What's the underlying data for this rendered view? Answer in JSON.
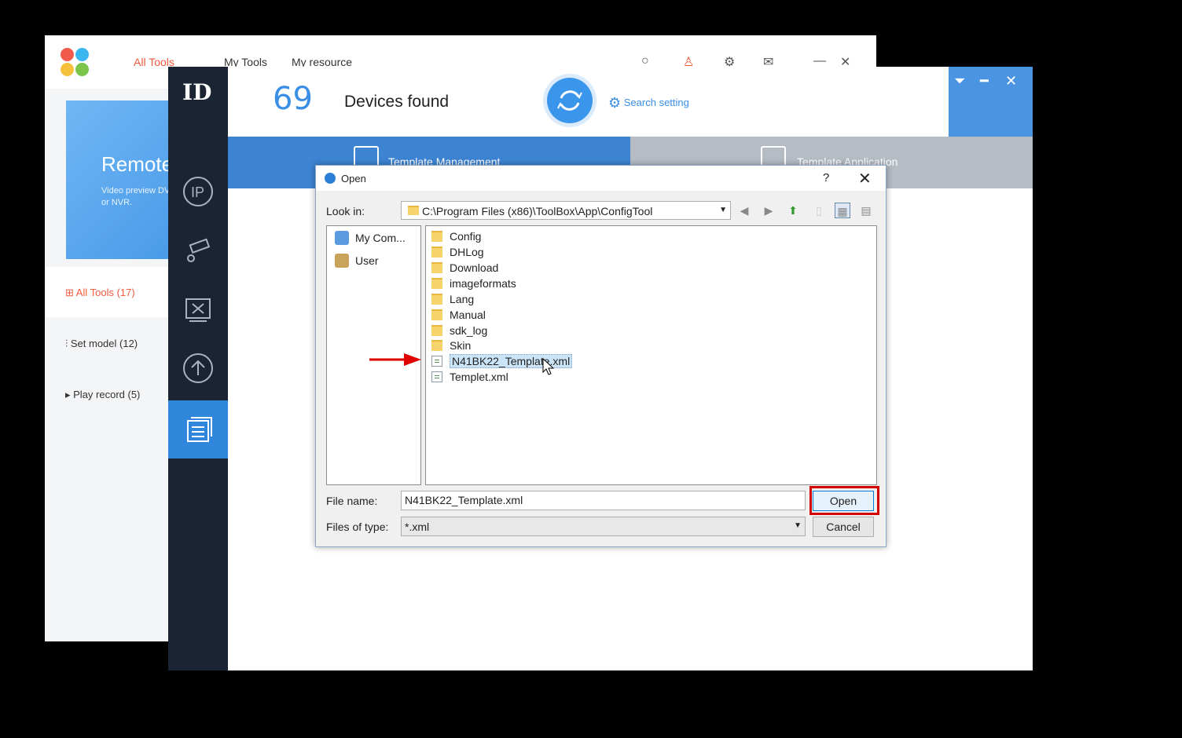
{
  "toolbox": {
    "tabs": [
      "All Tools",
      "My Tools",
      "My resource"
    ],
    "banner_title": "Remote",
    "banner_text": "Video preview DVR or NVR.",
    "menu": [
      "All Tools (17)",
      "Set model (12)",
      "Play record (5)"
    ]
  },
  "config": {
    "device_count": "69",
    "devices_found_label": "Devices found",
    "search_setting_label": "Search setting",
    "tabs": [
      "Template Management",
      "Template Application"
    ],
    "colors": {
      "accent": "#3a8ee6",
      "sidebar": "#1a2433",
      "active_side": "#2f86db"
    }
  },
  "dialog": {
    "title": "Open",
    "help": "?",
    "close": "✕",
    "look_in_label": "Look in:",
    "look_in_path": "C:\\Program Files (x86)\\ToolBox\\App\\ConfigTool",
    "places": [
      "My Com...",
      "User"
    ],
    "files": [
      {
        "name": "Config",
        "type": "folder"
      },
      {
        "name": "DHLog",
        "type": "folder"
      },
      {
        "name": "Download",
        "type": "folder"
      },
      {
        "name": "imageformats",
        "type": "folder"
      },
      {
        "name": "Lang",
        "type": "folder"
      },
      {
        "name": "Manual",
        "type": "folder"
      },
      {
        "name": "sdk_log",
        "type": "folder"
      },
      {
        "name": "Skin",
        "type": "folder"
      },
      {
        "name": "N41BK22_Template.xml",
        "type": "xml",
        "selected": true
      },
      {
        "name": "Templet.xml",
        "type": "xml"
      }
    ],
    "file_name_label": "File name:",
    "file_name_value": "N41BK22_Template.xml",
    "files_of_type_label": "Files of type:",
    "files_of_type_value": "*.xml",
    "open_button": "Open",
    "cancel_button": "Cancel"
  }
}
